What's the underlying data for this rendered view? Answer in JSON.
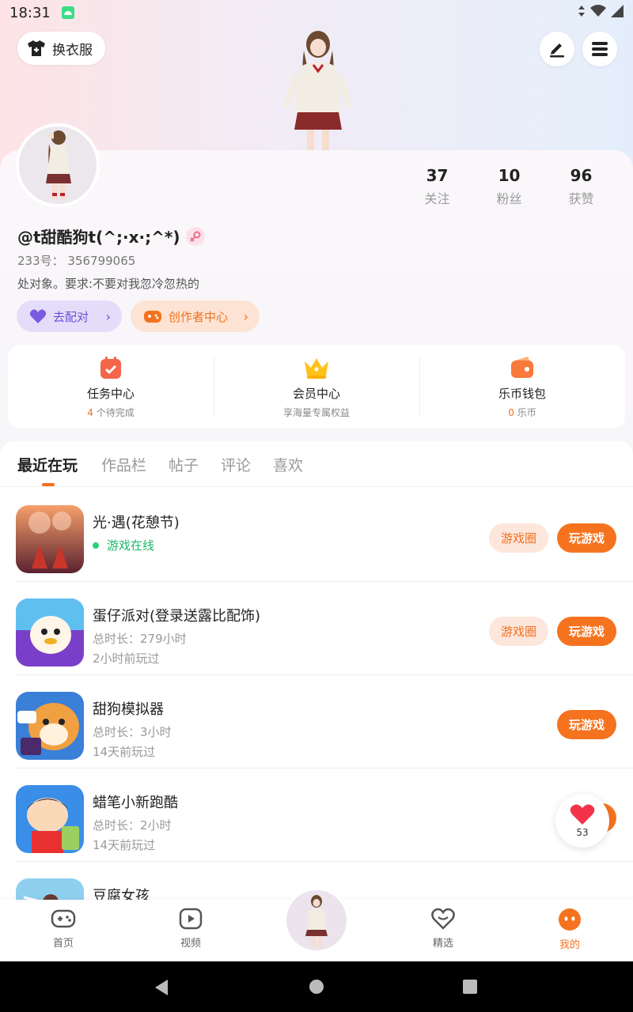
{
  "status": {
    "time": "18:31"
  },
  "header": {
    "outfit_label": "换衣服"
  },
  "profile": {
    "nickname": "@t甜酷狗t(^;·x·;^*)",
    "uid": "233号： 356799065",
    "bio": "处对象。要求:不要对我忽冷忽热的",
    "stats": [
      {
        "value": "37",
        "label": "关注"
      },
      {
        "value": "10",
        "label": "粉丝"
      },
      {
        "value": "96",
        "label": "获赞"
      }
    ],
    "match_label": "去配对",
    "creator_label": "创作者中心"
  },
  "services": [
    {
      "title": "任务中心",
      "highlight": "4",
      "sub": " 个待完成",
      "icon": "task-calendar-icon"
    },
    {
      "title": "会员中心",
      "highlight": "",
      "sub": "享海量专属权益",
      "icon": "crown-icon"
    },
    {
      "title": "乐币钱包",
      "highlight": "0",
      "sub": " 乐币",
      "icon": "wallet-icon"
    }
  ],
  "tabs": [
    "最近在玩",
    "作品栏",
    "帖子",
    "评论",
    "喜欢"
  ],
  "games": [
    {
      "name": "光·遇(花憩节)",
      "online": "游戏在线",
      "circle": "游戏圈",
      "play": "玩游戏"
    },
    {
      "name": "蛋仔派对(登录送露比配饰)",
      "duration": "总时长：279小时",
      "last": "2小时前玩过",
      "circle": "游戏圈",
      "play": "玩游戏"
    },
    {
      "name": "甜狗模拟器",
      "duration": "总时长：3小时",
      "last": "14天前玩过",
      "play": "玩游戏"
    },
    {
      "name": "蜡笔小新跑酷",
      "duration": "总时长：2小时",
      "last": "14天前玩过"
    },
    {
      "name": "豆腐女孩"
    }
  ],
  "like_count": "53",
  "bottom_nav": [
    {
      "label": "首页",
      "icon": "gamepad-icon"
    },
    {
      "label": "视频",
      "icon": "play-video-icon"
    },
    {
      "label": "精选",
      "icon": "heart-chat-icon"
    },
    {
      "label": "我的",
      "icon": "me-face-icon"
    }
  ],
  "colors": {
    "accent": "#f5731f",
    "online": "#1fb56a",
    "match": "#6c4fd6"
  }
}
